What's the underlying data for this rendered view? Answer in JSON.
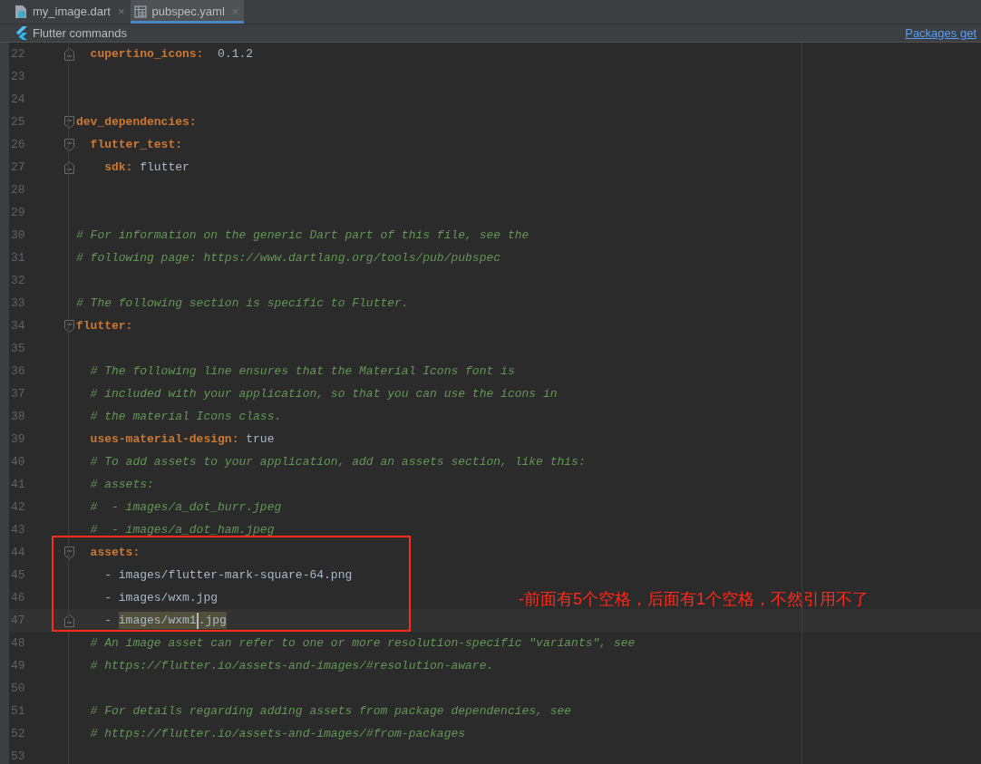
{
  "tabs": [
    {
      "label": "my_image.dart",
      "kind": "dart",
      "selected": false,
      "close": "×"
    },
    {
      "label": "pubspec.yaml",
      "kind": "yaml",
      "selected": true,
      "close": "×"
    }
  ],
  "toolbar": {
    "title": "Flutter commands",
    "link": "Packages get"
  },
  "lines": [
    {
      "number": "22",
      "fold_end": true,
      "segments": [
        {
          "kind": "key",
          "text": "  cupertino_icons:"
        },
        {
          "kind": "value",
          "text": "  0.1.2"
        }
      ]
    },
    {
      "number": "23"
    },
    {
      "number": "24"
    },
    {
      "number": "25",
      "fold_start": true,
      "segments": [
        {
          "kind": "key",
          "text": "dev_dependencies:"
        }
      ]
    },
    {
      "number": "26",
      "fold_start": true,
      "segments": [
        {
          "kind": "key",
          "text": "  flutter_test:"
        }
      ]
    },
    {
      "number": "27",
      "fold_end": true,
      "segments": [
        {
          "kind": "key",
          "text": "    sdk:"
        },
        {
          "kind": "value",
          "text": " flutter"
        }
      ]
    },
    {
      "number": "28"
    },
    {
      "number": "29"
    },
    {
      "number": "30",
      "segments": [
        {
          "kind": "comment",
          "text": "# For information on the generic Dart part of this file, see the"
        }
      ]
    },
    {
      "number": "31",
      "segments": [
        {
          "kind": "comment",
          "text": "# following page: https://www.dartlang.org/tools/pub/pubspec"
        }
      ]
    },
    {
      "number": "32"
    },
    {
      "number": "33",
      "segments": [
        {
          "kind": "comment",
          "text": "# The following section is specific to Flutter."
        }
      ]
    },
    {
      "number": "34",
      "fold_start": true,
      "segments": [
        {
          "kind": "key",
          "text": "flutter:"
        }
      ]
    },
    {
      "number": "35"
    },
    {
      "number": "36",
      "segments": [
        {
          "kind": "comment",
          "text": "  # The following line ensures that the Material Icons font is"
        }
      ]
    },
    {
      "number": "37",
      "segments": [
        {
          "kind": "comment",
          "text": "  # included with your application, so that you can use the icons in"
        }
      ]
    },
    {
      "number": "38",
      "segments": [
        {
          "kind": "comment",
          "text": "  # the material Icons class."
        }
      ]
    },
    {
      "number": "39",
      "segments": [
        {
          "kind": "key",
          "text": "  uses-material-design:"
        },
        {
          "kind": "value",
          "text": " true"
        }
      ]
    },
    {
      "number": "40",
      "segments": [
        {
          "kind": "comment",
          "text": "  # To add assets to your application, add an assets section, like this:"
        }
      ]
    },
    {
      "number": "41",
      "segments": [
        {
          "kind": "comment",
          "text": "  # assets:"
        }
      ]
    },
    {
      "number": "42",
      "segments": [
        {
          "kind": "comment",
          "text": "  #  - images/a_dot_burr.jpeg"
        }
      ]
    },
    {
      "number": "43",
      "segments": [
        {
          "kind": "comment",
          "text": "  #  - images/a_dot_ham.jpeg"
        }
      ]
    },
    {
      "number": "44",
      "fold_start": true,
      "segments": [
        {
          "kind": "key",
          "text": "  assets:"
        }
      ]
    },
    {
      "number": "45",
      "segments": [
        {
          "kind": "value",
          "text": "    - images/flutter-mark-square-64.png"
        }
      ]
    },
    {
      "number": "46",
      "segments": [
        {
          "kind": "value",
          "text": "    - images/wxm.jpg"
        }
      ]
    },
    {
      "number": "47",
      "fold_end": true,
      "current": true,
      "segments": [
        {
          "kind": "value",
          "text": "    - "
        },
        {
          "kind": "selection",
          "text": "images/wxm1"
        },
        {
          "kind": "cursor"
        },
        {
          "kind": "selection",
          "text": ".jpg"
        }
      ]
    },
    {
      "number": "48",
      "segments": [
        {
          "kind": "comment",
          "text": "  # An image asset can refer to one or more resolution-specific \"variants\", see"
        }
      ]
    },
    {
      "number": "49",
      "segments": [
        {
          "kind": "comment",
          "text": "  # https://flutter.io/assets-and-images/#resolution-aware."
        }
      ]
    },
    {
      "number": "50"
    },
    {
      "number": "51",
      "segments": [
        {
          "kind": "comment",
          "text": "  # For details regarding adding assets from package dependencies, see"
        }
      ]
    },
    {
      "number": "52",
      "segments": [
        {
          "kind": "comment",
          "text": "  # https://flutter.io/assets-and-images/#from-packages"
        }
      ]
    },
    {
      "number": "53"
    }
  ],
  "annotation": {
    "text": "-前面有5个空格，后面有1个空格，不然引用不了"
  }
}
